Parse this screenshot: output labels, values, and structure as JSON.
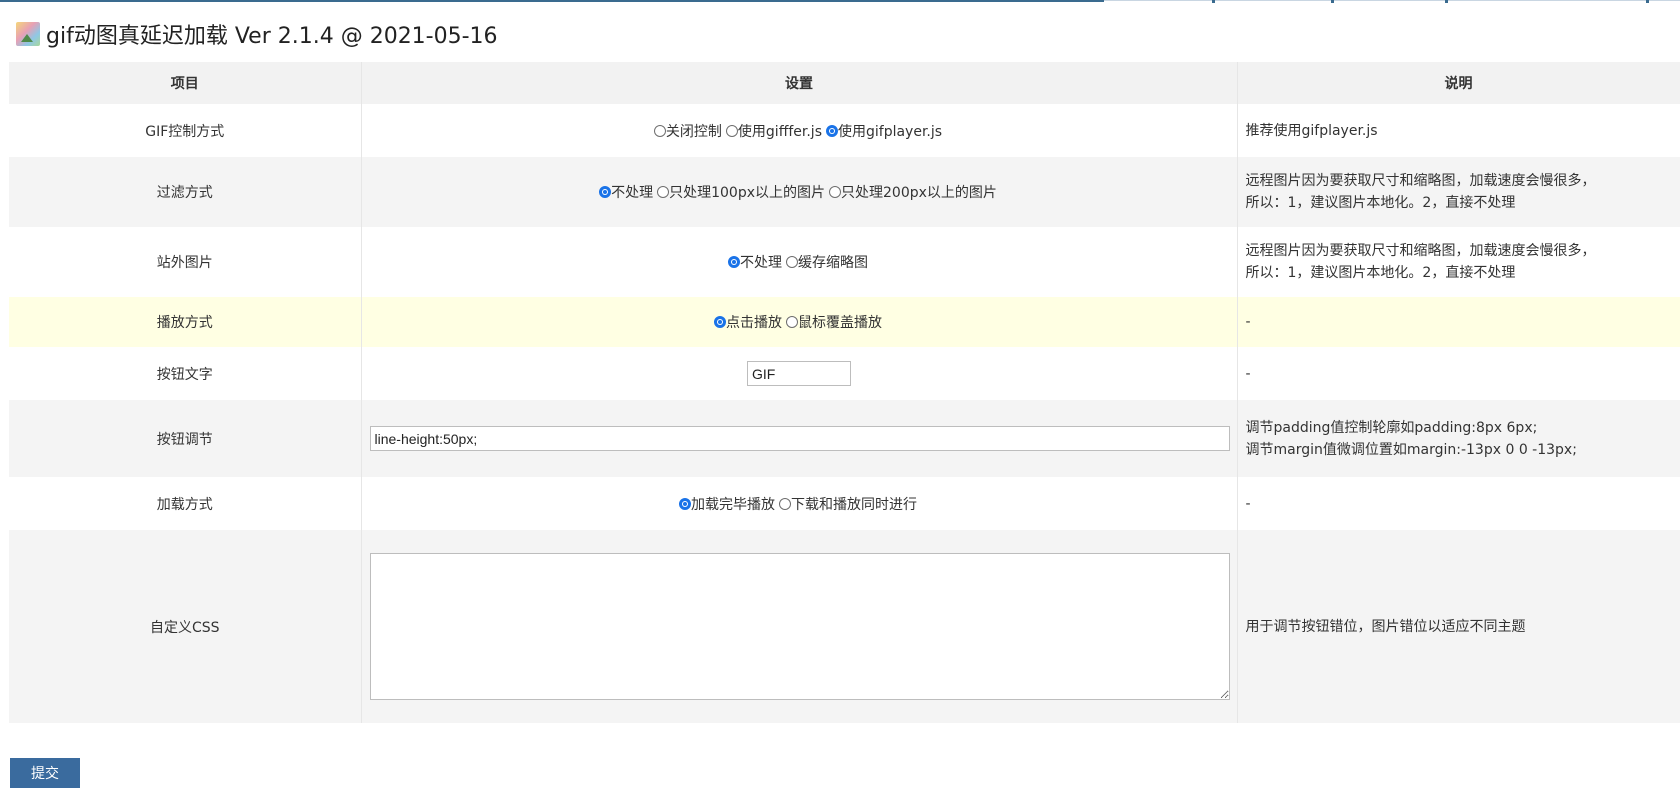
{
  "page": {
    "title": "gif动图真延迟加载 Ver 2.1.4 @ 2021-05-16"
  },
  "table": {
    "headers": [
      "项目",
      "设置",
      "说明"
    ],
    "rows": {
      "gif_control": {
        "label": "GIF控制方式",
        "options": [
          {
            "label": "关闭控制",
            "checked": false
          },
          {
            "label": "使用gifffer.js",
            "checked": false
          },
          {
            "label": "使用gifplayer.js",
            "checked": true
          }
        ],
        "desc": "推荐使用gifplayer.js"
      },
      "filter": {
        "label": "过滤方式",
        "options": [
          {
            "label": "不处理",
            "checked": true
          },
          {
            "label": "只处理100px以上的图片",
            "checked": false
          },
          {
            "label": "只处理200px以上的图片",
            "checked": false
          }
        ],
        "desc_line1": "远程图片因为要获取尺寸和缩略图，加载速度会慢很多，",
        "desc_line2": "所以：1，建议图片本地化。2，直接不处理"
      },
      "external": {
        "label": "站外图片",
        "options": [
          {
            "label": "不处理",
            "checked": true
          },
          {
            "label": "缓存缩略图",
            "checked": false
          }
        ],
        "desc_line1": "远程图片因为要获取尺寸和缩略图，加载速度会慢很多，",
        "desc_line2": "所以：1，建议图片本地化。2，直接不处理"
      },
      "play": {
        "label": "播放方式",
        "options": [
          {
            "label": "点击播放",
            "checked": true
          },
          {
            "label": "鼠标覆盖播放",
            "checked": false
          }
        ],
        "desc": "-"
      },
      "button_text": {
        "label": "按钮文字",
        "value": "GIF",
        "desc": "-"
      },
      "button_style": {
        "label": "按钮调节",
        "value": "line-height:50px;",
        "desc_line1": "调节padding值控制轮廓如padding:8px 6px;",
        "desc_line2": "调节margin值微调位置如margin:-13px 0 0 -13px;"
      },
      "load": {
        "label": "加载方式",
        "options": [
          {
            "label": "加载完毕播放",
            "checked": true
          },
          {
            "label": "下载和播放同时进行",
            "checked": false
          }
        ],
        "desc": "-"
      },
      "custom_css": {
        "label": "自定义CSS",
        "value": "",
        "desc": "用于调节按钮错位，图片错位以适应不同主题"
      }
    }
  },
  "submit_label": "提交",
  "colors": {
    "accent": "#3a6b9e",
    "header_bg": "#f2f2f2",
    "row_highlight": "#ffffe3",
    "radio_checked": "#1a73e8"
  },
  "icons": {
    "plugin": "image-icon"
  }
}
